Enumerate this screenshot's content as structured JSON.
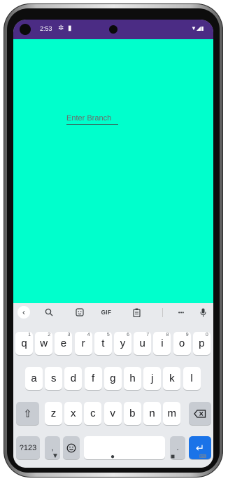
{
  "status_bar": {
    "time": "2:53",
    "signal_glyph": "▼◢▮"
  },
  "form": {
    "branch_placeholder": "Enter Branch"
  },
  "keyboard": {
    "row1": [
      {
        "k": "q",
        "h": "1"
      },
      {
        "k": "w",
        "h": "2"
      },
      {
        "k": "e",
        "h": "3"
      },
      {
        "k": "r",
        "h": "4"
      },
      {
        "k": "t",
        "h": "5"
      },
      {
        "k": "y",
        "h": "6"
      },
      {
        "k": "u",
        "h": "7"
      },
      {
        "k": "i",
        "h": "8"
      },
      {
        "k": "o",
        "h": "9"
      },
      {
        "k": "p",
        "h": "0"
      }
    ],
    "row2": [
      "a",
      "s",
      "d",
      "f",
      "g",
      "h",
      "j",
      "k",
      "l"
    ],
    "row3": [
      "z",
      "x",
      "c",
      "v",
      "b",
      "n",
      "m"
    ],
    "symbols_label": "?123",
    "comma_label": ",",
    "period_label": ".",
    "suggestion_gif": "GIF",
    "more_glyph": "•••"
  },
  "colors": {
    "app_background": "#00ffcc",
    "status_bar": "#4b2c84",
    "enter_key": "#1a73e8"
  },
  "icons": [
    "back-chevron-icon",
    "search-icon",
    "sticker-icon",
    "gif-icon",
    "clipboard-icon",
    "more-icon",
    "mic-icon",
    "shift-icon",
    "backspace-icon",
    "emoji-icon",
    "enter-icon",
    "nav-back-icon",
    "nav-home-icon",
    "nav-recents-icon",
    "keyboard-switch-icon"
  ]
}
